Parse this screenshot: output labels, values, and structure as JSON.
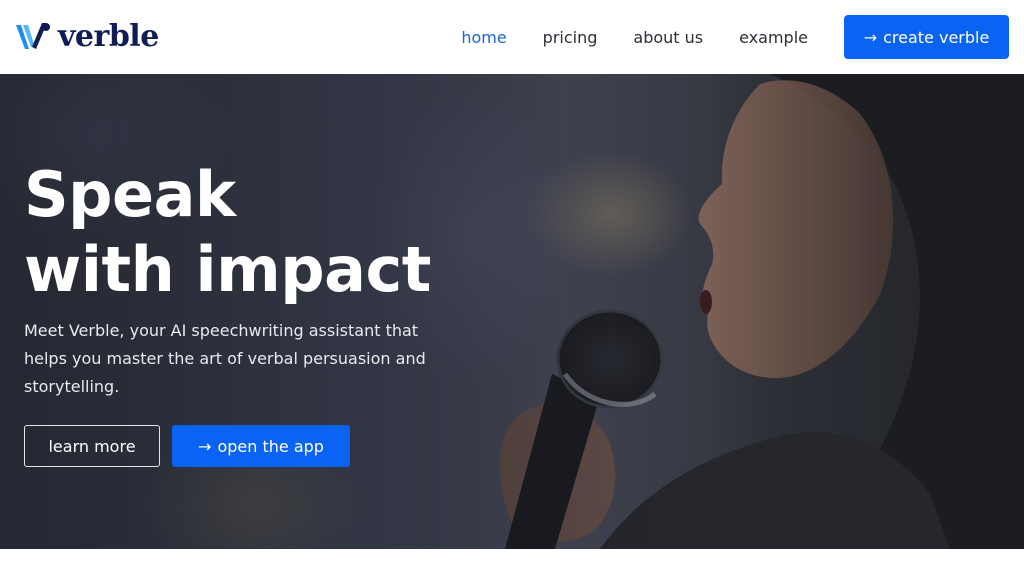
{
  "brand": {
    "name": "verble",
    "logo_icon": "verble-v-logo-icon",
    "primary_color": "#0b63f3",
    "wordmark_color": "#0f1c55"
  },
  "nav": {
    "links": [
      {
        "label": "home",
        "active": true
      },
      {
        "label": "pricing",
        "active": false
      },
      {
        "label": "about us",
        "active": false
      },
      {
        "label": "example",
        "active": false
      }
    ],
    "active_color": "#1769d6",
    "cta": {
      "arrow": "→",
      "label": "create verble"
    }
  },
  "hero": {
    "title_line1": "Speak",
    "title_line2": "with impact",
    "subtitle": "Meet Verble, your AI speechwriting assistant that helps you master the art of verbal persuasion and storytelling.",
    "secondary_button": "learn more",
    "primary_button": {
      "arrow": "→",
      "label": "open the app"
    },
    "background_image": "woman-speaking-into-microphone-photo"
  }
}
